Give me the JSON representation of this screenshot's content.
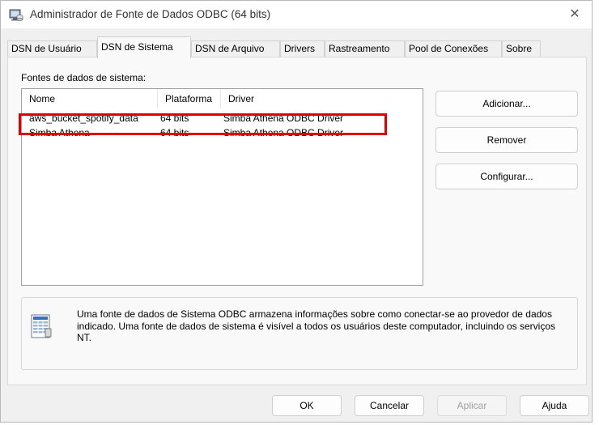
{
  "window": {
    "title": "Administrador de Fonte de Dados ODBC (64 bits)",
    "close_glyph": "✕"
  },
  "tabs": [
    {
      "label": "DSN de Usuário",
      "active": false
    },
    {
      "label": "DSN de Sistema",
      "active": true
    },
    {
      "label": "DSN de Arquivo",
      "active": false
    },
    {
      "label": "Drivers",
      "active": false
    },
    {
      "label": "Rastreamento",
      "active": false
    },
    {
      "label": "Pool de Conexões",
      "active": false
    },
    {
      "label": "Sobre",
      "active": false
    }
  ],
  "panel": {
    "group_label": "Fontes de dados de sistema:",
    "columns": [
      "Nome",
      "Plataforma",
      "Driver"
    ],
    "rows": [
      {
        "name": "aws_bucket_spotify_data",
        "platform": "64 bits",
        "driver": "Simba Athena ODBC Driver",
        "highlighted": true
      },
      {
        "name": "Simba Athena",
        "platform": "64 bits",
        "driver": "Simba Athena ODBC Driver",
        "highlighted": false
      }
    ],
    "buttons": {
      "add": "Adicionar...",
      "remove": "Remover",
      "configure": "Configurar..."
    },
    "info_text": "Uma fonte de dados de Sistema ODBC armazena informações sobre como conectar-se ao provedor de dados indicado. Uma fonte de dados de sistema é visível a todos os usuários deste computador, incluindo os serviços NT."
  },
  "footer": {
    "ok": "OK",
    "cancel": "Cancelar",
    "apply": "Aplicar",
    "help": "Ajuda"
  },
  "colors": {
    "highlight_border": "#e00000",
    "dialog_bg": "#f0f0f0",
    "panel_bg": "#f9f9f9"
  },
  "icons": {
    "title": "odbc-admin-icon",
    "close": "close-icon",
    "info": "data-sources-info-icon"
  }
}
